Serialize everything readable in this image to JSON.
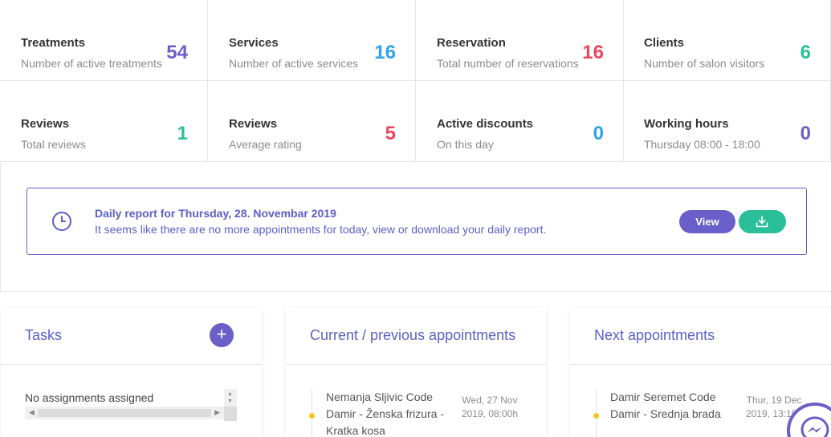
{
  "stats": [
    {
      "title": "Treatments",
      "sub": "Number of active treatments",
      "value": "54",
      "color": "#6a5fc8"
    },
    {
      "title": "Services",
      "sub": "Number of active services",
      "value": "16",
      "color": "#2ea3e8"
    },
    {
      "title": "Reservation",
      "sub": "Total number of reservations",
      "value": "16",
      "color": "#e8475d"
    },
    {
      "title": "Clients",
      "sub": "Number of salon visitors",
      "value": "6",
      "color": "#2bbf99"
    },
    {
      "title": "Reviews",
      "sub": "Total reviews",
      "value": "1",
      "color": "#2bbf99"
    },
    {
      "title": "Reviews",
      "sub": "Average rating",
      "value": "5",
      "color": "#e8475d"
    },
    {
      "title": "Active discounts",
      "sub": "On this day",
      "value": "0",
      "color": "#2ea3e8"
    },
    {
      "title": "Working hours",
      "sub": "Thursday 08:00 - 18:00",
      "value": "0",
      "color": "#6a5fc8"
    }
  ],
  "report": {
    "title": "Daily report for Thursday, 28. Novembar 2019",
    "text": "It seems like there are no more appointments for today, view or download your daily report.",
    "view_label": "View",
    "clock_icon": "clock-icon",
    "download_icon": "download-icon"
  },
  "tasks": {
    "title": "Tasks",
    "add_label": "+",
    "empty_text": "No assignments assigned"
  },
  "current": {
    "title": "Current / previous appointments",
    "items": [
      {
        "text": "Nemanja Sljivic Code Damir - Ženska frizura - Kratka kosa",
        "date": "Wed, 27 Nov 2019, 08:00h"
      }
    ]
  },
  "next": {
    "title": "Next appointments",
    "items": [
      {
        "text": "Damir Seremet Code Damir - Srednja brada",
        "date": "Thur, 19 Dec 2019, 13:15h"
      }
    ]
  },
  "colors": {
    "accent": "#5b5fc7",
    "purple": "#6a5fc8",
    "green": "#2bbf99",
    "red": "#e8475d",
    "blue": "#2ea3e8",
    "dot": "#f5c518"
  }
}
